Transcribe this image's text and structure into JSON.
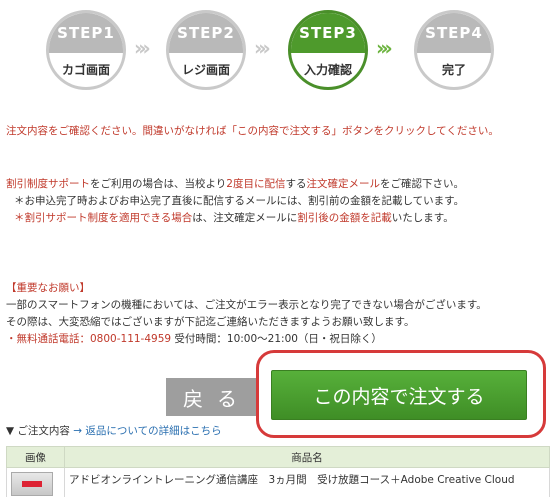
{
  "steps": [
    {
      "label": "STEP1",
      "name": "カゴ画面",
      "state": "inactive"
    },
    {
      "label": "STEP2",
      "name": "レジ画面",
      "state": "inactive"
    },
    {
      "label": "STEP3",
      "name": "入力確認",
      "state": "active"
    },
    {
      "label": "STEP4",
      "name": "完了",
      "state": "inactive"
    }
  ],
  "step_separator": "›››",
  "notice": "注文内容をご確認ください。間違いがなければ「この内容で注文する」ボタンをクリックしてください。",
  "discount": {
    "line1_pre": "割引制度サポート",
    "line1_mid": "をご利用の場合は、当校より",
    "line1_hl1": "2度目に配信",
    "line1_mid2": "する",
    "line1_hl2": "注文確定メール",
    "line1_post": "をご確認下さい。",
    "line2": "＊お申込完了時およびお申込完了直後に配信するメールには、割引前の金額を記載しています。",
    "line3_pre": "＊",
    "line3_hl1": "割引サポート制度を適用できる場合",
    "line3_mid": "は、注文確定メールに",
    "line3_hl2": "割引後の金額を記載",
    "line3_post": "いたします。"
  },
  "important": {
    "heading": "【重要なお願い】",
    "line1": "一部のスマートフォンの機種においては、ご注文がエラー表示となり完了できない場合がございます。",
    "line2": "その際は、大変恐縮ではございますが下記迄ご連絡いただきますようお願い致します。",
    "phone_label": "・無料通話電話：0800-111-4959",
    "hours": "受付時間：10:00～21:00（日・祝日除く）"
  },
  "buttons": {
    "back": "戻る",
    "order": "この内容で注文する"
  },
  "links": {
    "order_contents": "▼ ご注文内容",
    "returns": "→ 返品についての詳細はこちら"
  },
  "table": {
    "headers": [
      "画像",
      "商品名"
    ],
    "rows": [
      {
        "name": "アドビオンライントレーニング通信講座　3ヵ月間　受け放題コース＋Adobe Creative Cloud"
      }
    ]
  }
}
